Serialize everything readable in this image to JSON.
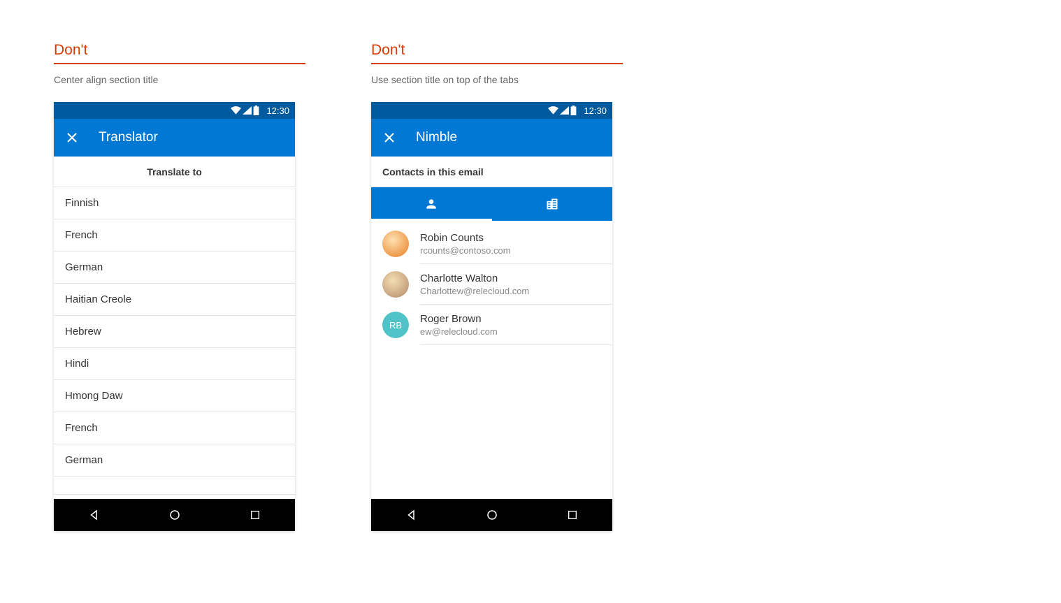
{
  "labels": {
    "dont": "Don't"
  },
  "example1": {
    "caption": "Center align section title",
    "status": {
      "time": "12:30"
    },
    "appbar": {
      "title": "Translator"
    },
    "section_title": "Translate to",
    "languages": [
      "Finnish",
      "French",
      "German",
      "Haitian Creole",
      "Hebrew",
      "Hindi",
      "Hmong Daw",
      "French",
      "German"
    ]
  },
  "example2": {
    "caption": "Use section title on top of the tabs",
    "status": {
      "time": "12:30"
    },
    "appbar": {
      "title": "Nimble"
    },
    "section_title": "Contacts in this email",
    "contacts": [
      {
        "name": "Robin Counts",
        "email": "rcounts@contoso.com",
        "initials": ""
      },
      {
        "name": "Charlotte Walton",
        "email": "Charlottew@relecloud.com",
        "initials": ""
      },
      {
        "name": "Roger Brown",
        "email": "ew@relecloud.com",
        "initials": "RB"
      }
    ]
  }
}
